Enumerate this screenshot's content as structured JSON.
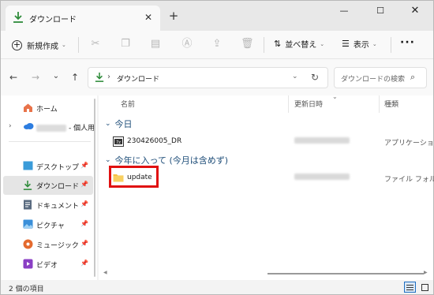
{
  "tab": {
    "title": "ダウンロード",
    "close": "✕",
    "new_tab": "+"
  },
  "window_controls": {
    "minimize": "—",
    "maximize": "☐",
    "close": "✕"
  },
  "command_bar": {
    "new_label": "新規作成",
    "sort_label": "並べ替え",
    "view_label": "表示",
    "more_label": "···"
  },
  "address": {
    "path": "ダウンロード",
    "search_placeholder": "ダウンロードの検索"
  },
  "sidebar": {
    "items": [
      {
        "label": "ホーム"
      },
      {
        "label": "- 個人用"
      },
      {
        "label": "デスクトップ"
      },
      {
        "label": "ダウンロード"
      },
      {
        "label": "ドキュメント"
      },
      {
        "label": "ピクチャ"
      },
      {
        "label": "ミュージック"
      },
      {
        "label": "ビデオ"
      }
    ]
  },
  "columns": {
    "name": "名前",
    "date": "更新日時",
    "type": "種類"
  },
  "groups": [
    {
      "label": "今日"
    },
    {
      "label": "今年に入って (今月は含めず)"
    }
  ],
  "files": [
    {
      "name": "230426005_DR",
      "type": "アプリケーション"
    },
    {
      "name": "update",
      "type": "ファイル フォルダー"
    }
  ],
  "status": {
    "item_count": "2 個の項目"
  },
  "colors": {
    "accent": "#1f6fc2",
    "highlight": "#e01010",
    "folder": "#f5c242",
    "download_green": "#2e8b3a"
  }
}
